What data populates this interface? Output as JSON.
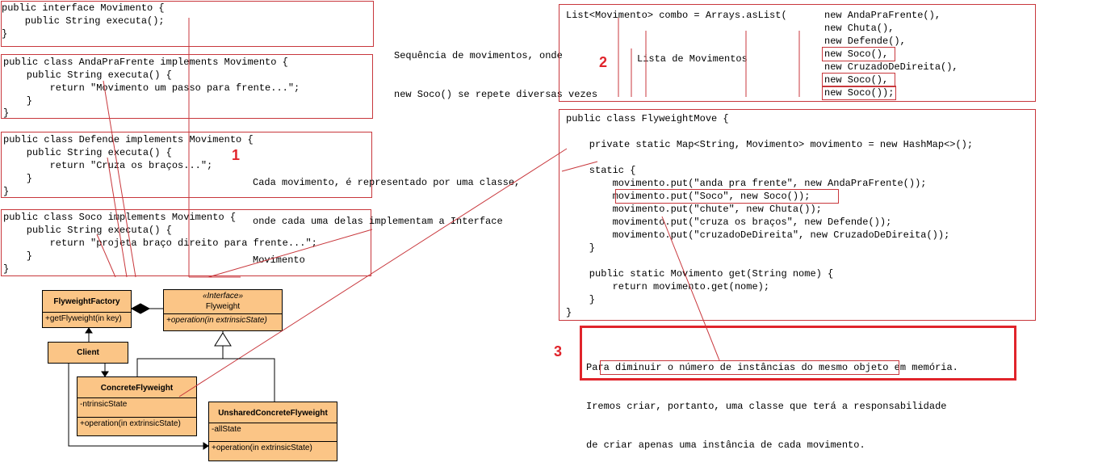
{
  "interface_block": {
    "lines": [
      "public interface Movimento {",
      "    public String executa();",
      "}"
    ]
  },
  "anda_block": {
    "lines": [
      "public class AndaPraFrente implements Movimento {",
      "    public String executa() {",
      "        return \"Movimento um passo para frente...\";",
      "    }",
      "}"
    ]
  },
  "defende_block": {
    "lines": [
      "public class Defende implements Movimento {",
      "    public String executa() {",
      "        return \"Cruza os braços...\";",
      "    }",
      "}"
    ]
  },
  "soco_block": {
    "lines": [
      "public class Soco implements Movimento {",
      "    public String executa() {",
      "        return \"projeta braço direito para frente...\";",
      "    }",
      "}"
    ]
  },
  "note_sequence": {
    "lines": [
      "Sequência de movimentos, onde",
      "new Soco() se repete diversas vezes"
    ]
  },
  "note_lista": "Lista de Movimentos",
  "note_classe": {
    "lines": [
      "Cada movimento, é representado por uma classe,",
      "onde cada uma delas implementam a Interface",
      "Movimento"
    ]
  },
  "combo_block": {
    "first_line": "List<Movimento> combo = Arrays.asList(",
    "items": [
      "new AndaPraFrente(),",
      "new Chuta(),",
      "new Defende(),",
      "new Soco(),",
      "new CruzadoDeDireita(),",
      "new Soco(),",
      "new Soco());"
    ]
  },
  "flyweight_block": {
    "lines": [
      "public class FlyweightMove {",
      "",
      "    private static Map<String, Movimento> movimento = new HashMap<>();",
      "",
      "    static {",
      "        movimento.put(\"anda pra frente\", new AndaPraFrente());",
      "        movimento.put(\"Soco\", new Soco());",
      "        movimento.put(\"chute\", new Chuta());",
      "        movimento.put(\"cruza os braços\", new Defende());",
      "        movimento.put(\"cruzadoDeDireita\", new CruzadoDeDireita());",
      "    }",
      "",
      "    public static Movimento get(String nome) {",
      "        return movimento.get(nome);",
      "    }",
      "}"
    ]
  },
  "note_reduce": {
    "lines": [
      "Para diminuir o número de instâncias do mesmo objeto em memória.",
      "Iremos criar, portanto, uma classe que terá a responsabilidade",
      "de criar apenas uma instância de cada movimento."
    ]
  },
  "labels": {
    "one": "1",
    "two": "2",
    "three": "3"
  },
  "uml": {
    "factory": {
      "name": "FlyweightFactory",
      "op": "+getFlyweight(in key)"
    },
    "interface": {
      "stereotype": "«Interface»",
      "name": "Flyweight",
      "op": "+operation(in extrinsicState)"
    },
    "client": {
      "name": "Client"
    },
    "concrete": {
      "name": "ConcreteFlyweight",
      "attr": "-ntrinsicState",
      "op": "+operation(in extrinsicState)"
    },
    "unshared": {
      "name": "UnsharedConcreteFlyweight",
      "attr": "-allState",
      "op": "+operation(in extrinsicState)"
    }
  },
  "colors": {
    "accent_red": "#e0242b",
    "box_red": "#c8373c",
    "uml_fill": "#fbc586"
  }
}
